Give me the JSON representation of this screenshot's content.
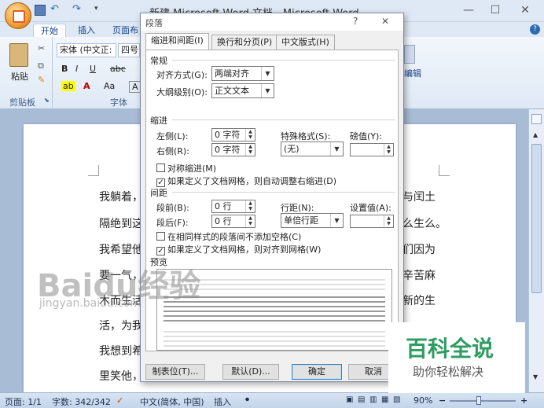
{
  "window": {
    "title": "新建 Microsoft Word 文档 - Microsoft Word",
    "quick_access": [
      "save-icon",
      "undo-icon",
      "redo-icon"
    ]
  },
  "ribbon": {
    "tabs": [
      "开始",
      "插入",
      "页面布"
    ],
    "clipboard": {
      "paste_label": "粘贴",
      "group_label": "剪贴板"
    },
    "font": {
      "name": "宋体 (中文正:",
      "size": "四号",
      "group_label": "字体"
    },
    "right_fragment": "编辑"
  },
  "document": {
    "lines": [
      {
        "left": "我躺着，",
        "right": "与闰土"
      },
      {
        "left": "隔绝到这",
        "right": "么生么。"
      },
      {
        "left": "我希望他",
        "right": "们因为"
      },
      {
        "left": "要一气，",
        "right": "辛苦麻"
      },
      {
        "left": "木而生活",
        "right": "新的生"
      },
      {
        "left": "活，为我",
        "right": ""
      },
      {
        "left": "我想到希",
        "right": ""
      },
      {
        "left": "里笑他，",
        "right": ""
      }
    ]
  },
  "dialog": {
    "title": "段落",
    "help": "?",
    "close": "✕",
    "tabs": [
      "缩进和间距(I)",
      "换行和分页(P)",
      "中文版式(H)"
    ],
    "general": {
      "section": "常规",
      "alignment_label": "对齐方式(G):",
      "alignment_value": "两端对齐",
      "outline_label": "大纲级别(O):",
      "outline_value": "正文文本"
    },
    "indent": {
      "section": "缩进",
      "left_label": "左侧(L):",
      "left_value": "0 字符",
      "right_label": "右侧(R):",
      "right_value": "0 字符",
      "special_label": "特殊格式(S):",
      "special_value": "(无)",
      "by_label": "磅值(Y):",
      "by_value": "",
      "mirror": "对称缩进(M)",
      "auto_adjust": "如果定义了文档网格，则自动调整右缩进(D)",
      "mirror_checked": false,
      "auto_adjust_checked": true
    },
    "spacing": {
      "section": "间距",
      "before_label": "段前(B):",
      "before_value": "0 行",
      "after_label": "段后(F):",
      "after_value": "0 行",
      "line_label": "行距(N):",
      "line_value": "单倍行距",
      "at_label": "设置值(A):",
      "at_value": "",
      "no_space": "在相同样式的段落间不添加空格(C)",
      "snap_grid": "如果定义了文档网格，则对齐到网格(W)",
      "no_space_checked": false,
      "snap_grid_checked": true
    },
    "preview": {
      "section": "预览"
    },
    "buttons": {
      "tabs": "制表位(T)...",
      "default": "默认(D)...",
      "ok": "确定",
      "cancel": "取消"
    }
  },
  "statusbar": {
    "page": "页面: 1/1",
    "words": "字数: 342/342",
    "language": "中文(简体, 中国)",
    "mode": "插入",
    "zoom": "90%"
  },
  "watermark": {
    "main": "Baidu经验",
    "sub": "jingyan.baidu.com"
  },
  "baike": {
    "main": "百科全说",
    "sub": "助你轻松解决"
  }
}
